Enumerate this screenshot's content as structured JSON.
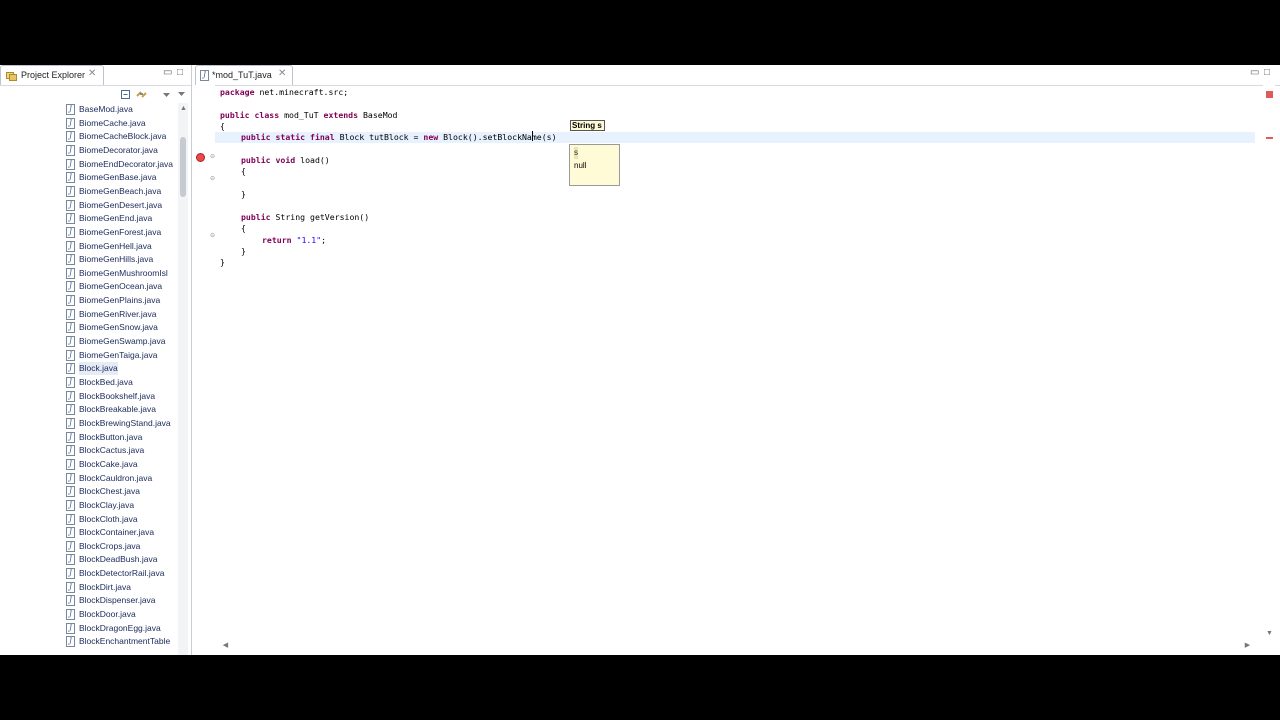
{
  "project_explorer": {
    "title": "Project Explorer",
    "close": "✕",
    "minimize": "▭",
    "maximize": "□",
    "files": [
      "BaseMod.java",
      "BiomeCache.java",
      "BiomeCacheBlock.java",
      "BiomeDecorator.java",
      "BiomeEndDecorator.java",
      "BiomeGenBase.java",
      "BiomeGenBeach.java",
      "BiomeGenDesert.java",
      "BiomeGenEnd.java",
      "BiomeGenForest.java",
      "BiomeGenHell.java",
      "BiomeGenHills.java",
      "BiomeGenMushroomIsl",
      "BiomeGenOcean.java",
      "BiomeGenPlains.java",
      "BiomeGenRiver.java",
      "BiomeGenSnow.java",
      "BiomeGenSwamp.java",
      "BiomeGenTaiga.java",
      "Block.java",
      "BlockBed.java",
      "BlockBookshelf.java",
      "BlockBreakable.java",
      "BlockBrewingStand.java",
      "BlockButton.java",
      "BlockCactus.java",
      "BlockCake.java",
      "BlockCauldron.java",
      "BlockChest.java",
      "BlockClay.java",
      "BlockCloth.java",
      "BlockContainer.java",
      "BlockCrops.java",
      "BlockDeadBush.java",
      "BlockDetectorRail.java",
      "BlockDirt.java",
      "BlockDispenser.java",
      "BlockDoor.java",
      "BlockDragonEgg.java",
      "BlockEnchantmentTable"
    ],
    "selected_index": 19
  },
  "editor": {
    "tab_title": "*mod_TuT.java",
    "tab_close": "✕",
    "code": {
      "package_kw": "package",
      "package_name": " net.minecraft.src;",
      "class_kw": "public class",
      "class_name": " mod_TuT ",
      "extends_kw": "extends",
      "base_class": " BaseMod",
      "open_brace": "{",
      "field_kw": "public static final",
      "field_decl": " Block tutBlock = ",
      "new_kw": "new",
      "field_init": " Block().setBlockName(s)",
      "load_kw": "public void",
      "load_sig": " load()",
      "brace_open": "{",
      "brace_close": "}",
      "getversion_kw": "public",
      "getversion_sig": " String getVersion()",
      "return_kw": "return",
      "return_value": "\"1.1\"",
      "semicolon": ";",
      "class_close": "}"
    }
  },
  "content_assist": {
    "hint": "String s",
    "proposals": [
      "s",
      "null"
    ],
    "selected": 0
  }
}
